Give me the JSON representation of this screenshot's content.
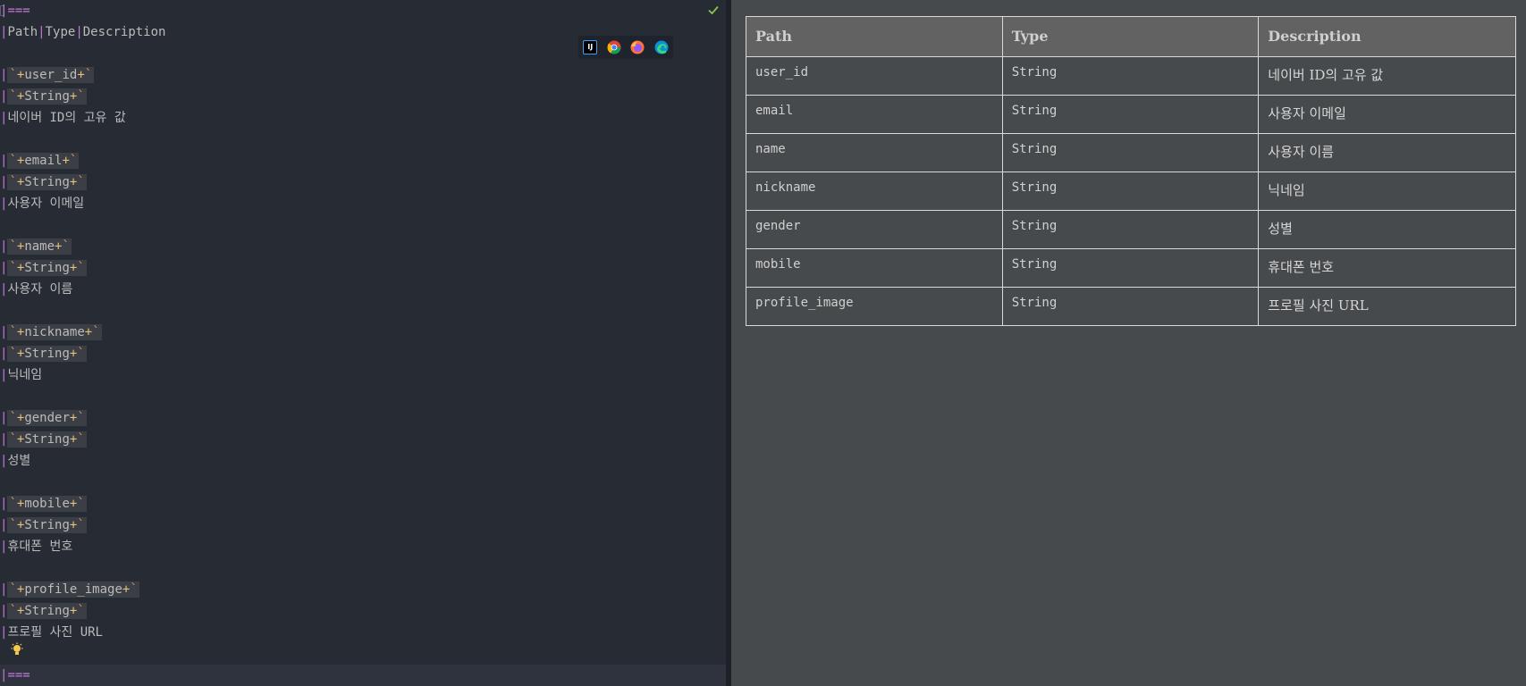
{
  "editor": {
    "header_line": "===",
    "columns_line": {
      "cols": [
        "Path",
        "Type",
        "Description"
      ]
    },
    "rows": [
      {
        "path": "user_id",
        "type": "String",
        "desc": "네이버 ID의 고유 값"
      },
      {
        "path": "email",
        "type": "String",
        "desc": "사용자 이메일"
      },
      {
        "path": "name",
        "type": "String",
        "desc": "사용자 이름"
      },
      {
        "path": "nickname",
        "type": "String",
        "desc": "닉네임"
      },
      {
        "path": "gender",
        "type": "String",
        "desc": "성별"
      },
      {
        "path": "mobile",
        "type": "String",
        "desc": "휴대폰 번호"
      },
      {
        "path": "profile_image",
        "type": "String",
        "desc": "프로필 사진 URL"
      }
    ],
    "footer_line": "===",
    "icons": [
      "check-icon",
      "intellij-icon",
      "chrome-icon",
      "firefox-icon",
      "edge-icon",
      "lightbulb-icon"
    ]
  },
  "preview": {
    "headers": [
      "Path",
      "Type",
      "Description"
    ],
    "rows": [
      [
        "user_id",
        "String",
        "네이버 ID의 고유 값"
      ],
      [
        "email",
        "String",
        "사용자 이메일"
      ],
      [
        "name",
        "String",
        "사용자 이름"
      ],
      [
        "nickname",
        "String",
        "닉네임"
      ],
      [
        "gender",
        "String",
        "성별"
      ],
      [
        "mobile",
        "String",
        "휴대폰 번호"
      ],
      [
        "profile_image",
        "String",
        "프로필 사진 URL"
      ]
    ]
  },
  "colors": {
    "editor_bg": "#262b34",
    "preview_bg": "#464a4d",
    "pipe": "#c678dd",
    "plus": "#e5c07b",
    "backtick": "#d19a66",
    "check": "#8bc34a"
  }
}
